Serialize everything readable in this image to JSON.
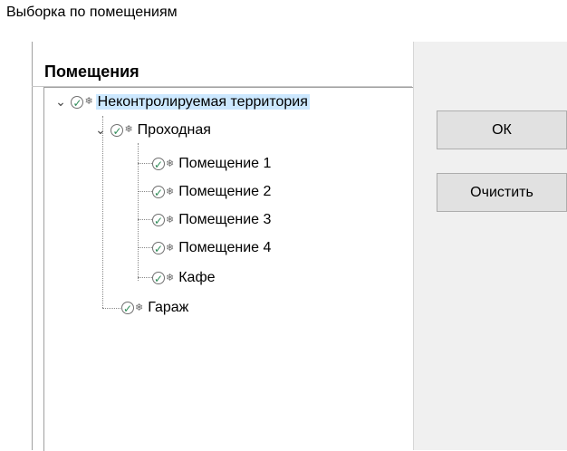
{
  "window": {
    "title": "Выборка по помещениям"
  },
  "tree": {
    "header": "Помещения",
    "nodes": [
      {
        "label": "Неконтролируемая территория"
      },
      {
        "label": "Проходная"
      },
      {
        "label": "Помещение 1"
      },
      {
        "label": "Помещение 2"
      },
      {
        "label": "Помещение 3"
      },
      {
        "label": "Помещение 4"
      },
      {
        "label": "Кафе"
      },
      {
        "label": "Гараж"
      }
    ]
  },
  "buttons": {
    "ok": "ОК",
    "clear": "Очистить"
  },
  "colors": {
    "selection": "#cce8ff",
    "button_bg": "#e1e1e1",
    "panel_bg": "#f0f0f0"
  }
}
